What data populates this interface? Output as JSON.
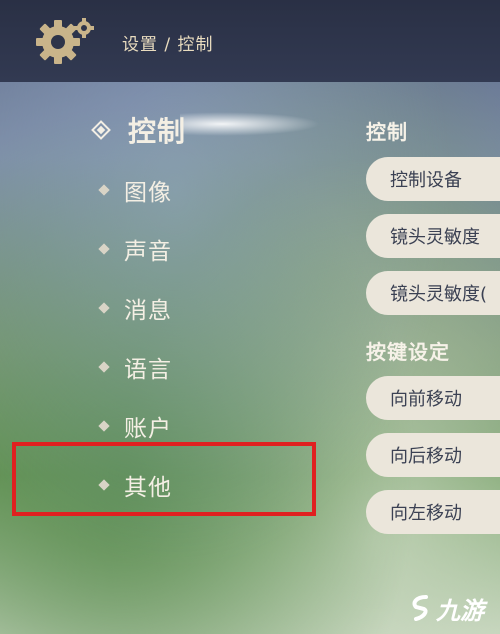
{
  "header": {
    "breadcrumb": "设置 / 控制"
  },
  "menu": {
    "items": [
      {
        "label": "控制",
        "active": true
      },
      {
        "label": "图像"
      },
      {
        "label": "声音"
      },
      {
        "label": "消息"
      },
      {
        "label": "语言"
      },
      {
        "label": "账户"
      },
      {
        "label": "其他"
      }
    ]
  },
  "panel": {
    "section_control": "控制",
    "control_items": [
      "控制设备",
      "镜头灵敏度",
      "镜头灵敏度("
    ],
    "section_keys": "按键设定",
    "key_items": [
      "向前移动",
      "向后移动",
      "向左移动"
    ]
  },
  "watermark": {
    "text": "九游"
  },
  "colors": {
    "highlight": "#e02020",
    "gear": "#c9b48a",
    "text_light": "#f4efe4",
    "pill_bg": "#ebe6db",
    "pill_text": "#3b4153"
  },
  "icons": [
    "gear-icon",
    "diamond-bullet-icon",
    "watermark-logo-icon"
  ]
}
